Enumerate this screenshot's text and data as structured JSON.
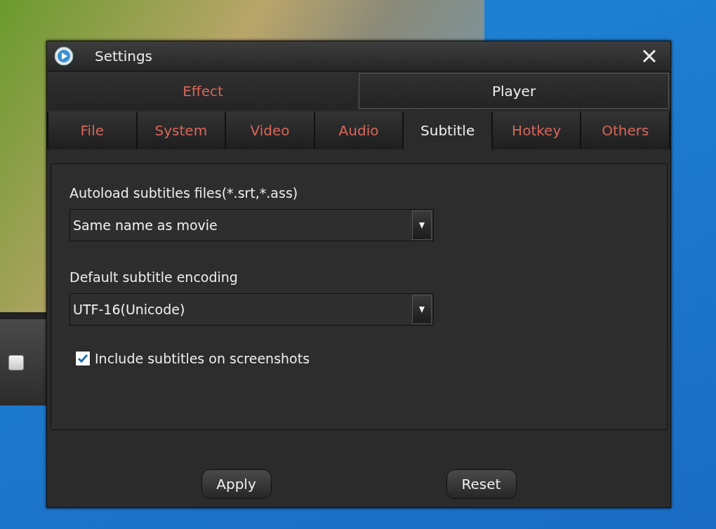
{
  "window": {
    "title": "Settings"
  },
  "category_tabs": [
    {
      "label": "Effect",
      "selected": false
    },
    {
      "label": "Player",
      "selected": true
    }
  ],
  "tabs": [
    {
      "label": "File",
      "selected": false
    },
    {
      "label": "System",
      "selected": false
    },
    {
      "label": "Video",
      "selected": false
    },
    {
      "label": "Audio",
      "selected": false
    },
    {
      "label": "Subtitle",
      "selected": true
    },
    {
      "label": "Hotkey",
      "selected": false
    },
    {
      "label": "Others",
      "selected": false
    }
  ],
  "panel": {
    "fields": [
      {
        "label": "Autoload subtitles files(*.srt,*.ass)",
        "value": "Same name as movie"
      },
      {
        "label": "Default subtitle encoding",
        "value": "UTF-16(Unicode)"
      }
    ],
    "checkbox": {
      "label": "Include subtitles on screenshots",
      "checked": true
    }
  },
  "buttons": [
    "Apply",
    "Reset"
  ]
}
